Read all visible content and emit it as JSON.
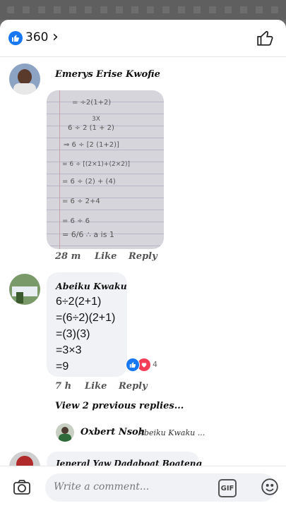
{
  "header": {
    "reaction_count": "360"
  },
  "comments": [
    {
      "author": "Emerys Erise Kwofie",
      "time": "28 m",
      "like": "Like",
      "reply": "Reply",
      "photo_lines": [
        "= ÷2(1+2)",
        "3X",
        "6 ÷ 2 (1 + 2)",
        "⇒ 6 ÷ [2 (1+2)]",
        "= 6 ÷ [(2×1)+(2×2)]",
        "= 6 ÷ (2) + (4)",
        "= 6 ÷ 2+4",
        "= 6 ÷ 6",
        "= 6/6  ∴ a is 1"
      ]
    },
    {
      "author": "Abeiku Kwaku",
      "lines": [
        "6÷2(2+1)",
        "=(6÷2)(2+1)",
        "=(3)(3)",
        "=3×3",
        "=9"
      ],
      "reaction_count": "4",
      "time": "7 h",
      "like": "Like",
      "reply": "Reply",
      "view_replies": "View 2 previous replies...",
      "reply_preview": {
        "author": "Oxbert Nsoh",
        "mention": "Abeiku Kwaku ..."
      }
    },
    {
      "author": "Jeneral Yaw Dadaboat Boateng"
    }
  ],
  "composer": {
    "placeholder": "Write a comment...",
    "gif_label": "GIF"
  },
  "colors": {
    "accent": "#1877f2",
    "love": "#f33e58"
  }
}
